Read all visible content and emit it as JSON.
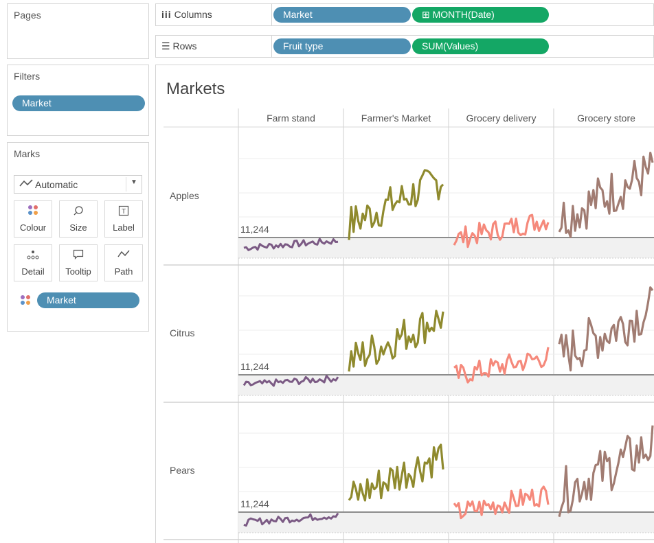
{
  "pages_panel": {
    "title": "Pages"
  },
  "filters_panel": {
    "title": "Filters",
    "pills": [
      "Market"
    ]
  },
  "marks_panel": {
    "title": "Marks",
    "mark_type": "Automatic",
    "buttons": [
      "Colour",
      "Size",
      "Label",
      "Detail",
      "Tooltip",
      "Path"
    ],
    "color_pill": "Market"
  },
  "columns_shelf": {
    "label": "Columns",
    "pills": [
      "Market",
      "⊞ MONTH(Date)"
    ]
  },
  "rows_shelf": {
    "label": "Rows",
    "pills": [
      "Fruit type",
      "SUM(Values)"
    ]
  },
  "view": {
    "title": "Markets",
    "columns": [
      "Farm stand",
      "Farmer's Market",
      "Grocery delivery",
      "Grocery store"
    ],
    "rows": [
      "Apples",
      "Citrus",
      "Pears"
    ],
    "reference_label": "11,244"
  },
  "colors": {
    "pill_blue": "#4e8fb3",
    "pill_green": "#14a765",
    "farm_stand": "#7b5a84",
    "farmers_market": "#8f8a2e",
    "grocery_delivery": "#f5897b",
    "grocery_store": "#a17c72"
  }
}
